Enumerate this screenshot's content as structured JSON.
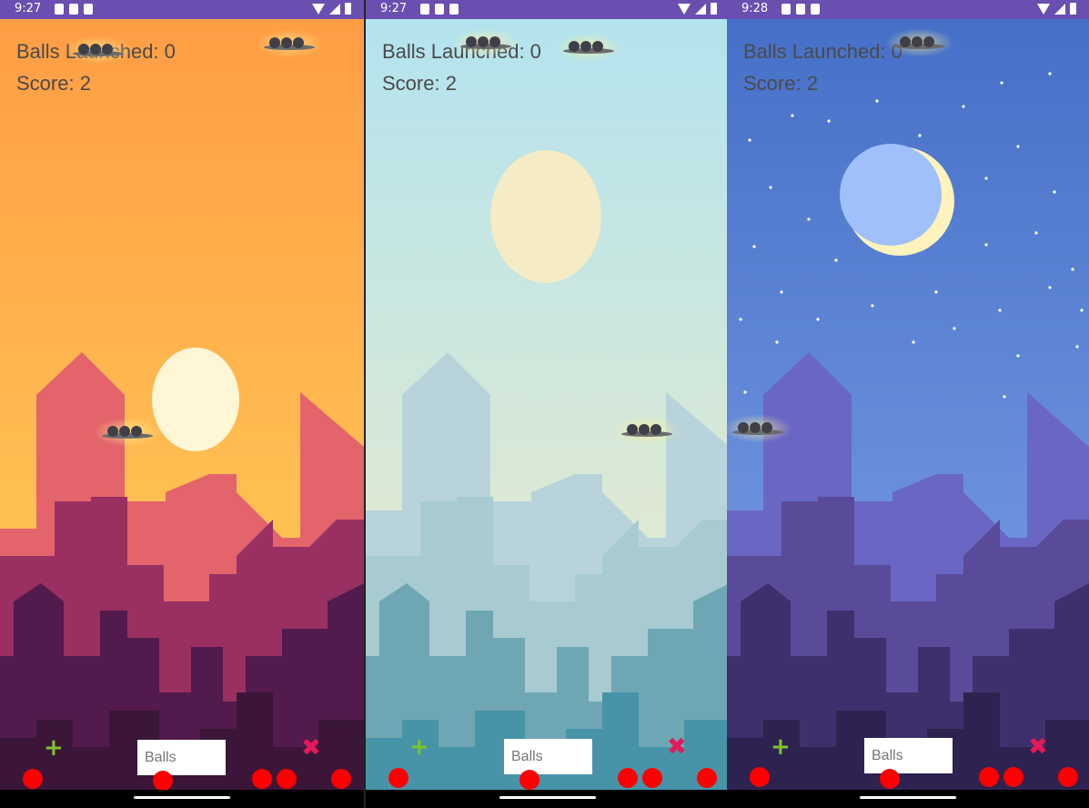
{
  "panels": [
    {
      "theme": "sunset",
      "status": {
        "time": "9:27"
      },
      "hud": {
        "balls_launched": "Balls Launched: 0",
        "score": "Score: 2"
      },
      "controls": {
        "add_symbol": "+",
        "close_symbol": "✖",
        "balls_placeholder": "Balls"
      },
      "colors": {
        "sky_top": "#ff9d45",
        "sky_bottom": "#ffd35a",
        "celestial": "#fff6d5",
        "b1": "#e3646a",
        "b2": "#9a2f62",
        "b3": "#521a4d",
        "b4": "#3b1638"
      }
    },
    {
      "theme": "day",
      "status": {
        "time": "9:27"
      },
      "hud": {
        "balls_launched": "Balls Launched: 0",
        "score": "Score: 2"
      },
      "controls": {
        "add_symbol": "+",
        "close_symbol": "✖",
        "balls_placeholder": "Balls"
      },
      "colors": {
        "sky_top": "#b3e3ef",
        "sky_bottom": "#f3ecc5",
        "celestial": "#f5ecc5",
        "b1": "#b8d4da",
        "b2": "#a8cbd2",
        "b3": "#6fa6b4",
        "b4": "#4793a8"
      }
    },
    {
      "theme": "night",
      "status": {
        "time": "9:28"
      },
      "hud": {
        "balls_launched": "Balls Launched: 0",
        "score": "Score: 2"
      },
      "controls": {
        "add_symbol": "+",
        "close_symbol": "✖",
        "balls_placeholder": "Balls"
      },
      "colors": {
        "sky_top": "#4670c8",
        "sky_bottom": "#7fa2e6",
        "celestial": "#9fc0fa",
        "moon_edge": "#fff3bd",
        "b1": "#6a67c4",
        "b2": "#5a4a9a",
        "b3": "#3f2f6d",
        "b4": "#2e2250"
      }
    }
  ]
}
